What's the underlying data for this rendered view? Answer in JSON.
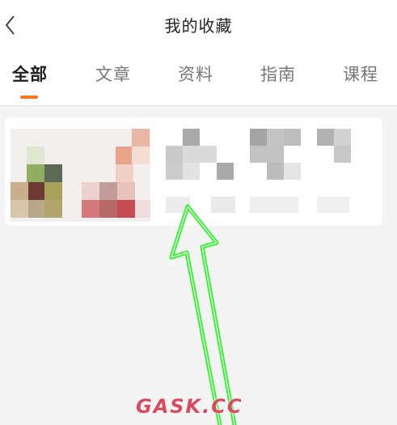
{
  "header": {
    "title": "我的收藏",
    "back_icon": "chevron-left-icon"
  },
  "tabs": [
    {
      "label": "全部",
      "active": true
    },
    {
      "label": "文章",
      "active": false
    },
    {
      "label": "资料",
      "active": false
    },
    {
      "label": "指南",
      "active": false
    },
    {
      "label": "课程",
      "active": false
    }
  ],
  "colors": {
    "accent": "#ff7a1f",
    "annotation_arrow": "#33ee33",
    "background": "#f4f4f4"
  },
  "favorites": [
    {
      "thumbnail": "pixelated-thumbnail",
      "text": ""
    }
  ],
  "watermark": "GASK.CC"
}
